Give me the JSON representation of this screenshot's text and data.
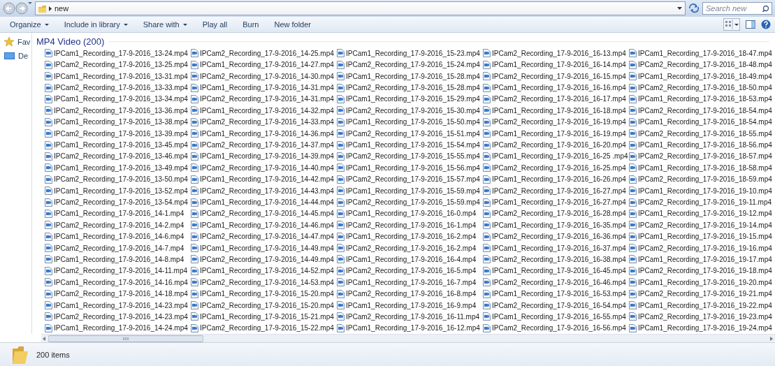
{
  "address_bar": {
    "path": "new",
    "search": {
      "placeholder": "Search new"
    }
  },
  "toolbar": {
    "buttons": [
      {
        "label": "Organize",
        "kind": "menu"
      },
      {
        "label": "Include in library",
        "kind": "menu"
      },
      {
        "label": "Share with",
        "kind": "menu"
      },
      {
        "label": "Play all",
        "kind": "plain"
      },
      {
        "label": "Burn",
        "kind": "plain"
      },
      {
        "label": "New folder",
        "kind": "plain"
      }
    ]
  },
  "navigation": [
    {
      "label": "Fav",
      "kind": "favorites"
    },
    {
      "label": "De",
      "kind": "desktop"
    }
  ],
  "group": {
    "title": "MP4 Video (200)",
    "files": [
      "IPCam1_Recording_17-9-2016_13-24.mp4",
      "IPCam2_Recording_17-9-2016_13-25.mp4",
      "IPCam1_Recording_17-9-2016_13-31.mp4",
      "IPCam2_Recording_17-9-2016_13-33.mp4",
      "IPCam1_Recording_17-9-2016_13-34.mp4",
      "IPCam2_Recording_17-9-2016_13-36.mp4",
      "IPCam1_Recording_17-9-2016_13-38.mp4",
      "IPCam2_Recording_17-9-2016_13-39.mp4",
      "IPCam1_Recording_17-9-2016_13-45.mp4",
      "IPCam2_Recording_17-9-2016_13-46.mp4",
      "IPCam1_Recording_17-9-2016_13-49.mp4",
      "IPCam2_Recording_17-9-2016_13-50.mp4",
      "IPCam1_Recording_17-9-2016_13-52.mp4",
      "IPCam2_Recording_17-9-2016_13-54.mp4",
      "IPCam1_Recording_17-9-2016_14-1.mp4",
      "IPCam2_Recording_17-9-2016_14-2.mp4",
      "IPCam1_Recording_17-9-2016_14-6.mp4",
      "IPCam2_Recording_17-9-2016_14-7.mp4",
      "IPCam1_Recording_17-9-2016_14-8.mp4",
      "IPCam2_Recording_17-9-2016_14-11.mp4",
      "IPCam1_Recording_17-9-2016_14-16.mp4",
      "IPCam2_Recording_17-9-2016_14-18.mp4",
      "IPCam1_Recording_17-9-2016_14-23.mp4",
      "IPCam2_Recording_17-9-2016_14-23.mp4",
      "IPCam1_Recording_17-9-2016_14-24.mp4",
      "IPCam2_Recording_17-9-2016_14-25.mp4",
      "IPCam1_Recording_17-9-2016_14-27.mp4",
      "IPCam2_Recording_17-9-2016_14-30.mp4",
      "IPCam1_Recording_17-9-2016_14-31.mp4",
      "IPCam2_Recording_17-9-2016_14-31.mp4",
      "IPCam1_Recording_17-9-2016_14-32.mp4",
      "IPCam2_Recording_17-9-2016_14-33.mp4",
      "IPCam1_Recording_17-9-2016_14-36.mp4",
      "IPCam2_Recording_17-9-2016_14-37.mp4",
      "IPCam1_Recording_17-9-2016_14-39.mp4",
      "IPCam2_Recording_17-9-2016_14-40.mp4",
      "IPCam1_Recording_17-9-2016_14-42.mp4",
      "IPCam2_Recording_17-9-2016_14-43.mp4",
      "IPCam1_Recording_17-9-2016_14-44.mp4",
      "IPCam2_Recording_17-9-2016_14-45.mp4",
      "IPCam1_Recording_17-9-2016_14-46.mp4",
      "IPCam2_Recording_17-9-2016_14-47.mp4",
      "IPCam1_Recording_17-9-2016_14-49.mp4",
      "IPCam2_Recording_17-9-2016_14-49.mp4",
      "IPCam1_Recording_17-9-2016_14-52.mp4",
      "IPCam2_Recording_17-9-2016_14-53.mp4",
      "IPCam1_Recording_17-9-2016_15-20.mp4",
      "IPCam2_Recording_17-9-2016_15-20.mp4",
      "IPCam1_Recording_17-9-2016_15-21.mp4",
      "IPCam2_Recording_17-9-2016_15-22.mp4",
      "IPCam1_Recording_17-9-2016_15-23.mp4",
      "IPCam2_Recording_17-9-2016_15-24.mp4",
      "IPCam1_Recording_17-9-2016_15-28.mp4",
      "IPCam2_Recording_17-9-2016_15-28.mp4",
      "IPCam1_Recording_17-9-2016_15-29.mp4",
      "IPCam2_Recording_17-9-2016_15-30.mp4",
      "IPCam1_Recording_17-9-2016_15-50.mp4",
      "IPCam2_Recording_17-9-2016_15-51.mp4",
      "IPCam1_Recording_17-9-2016_15-54.mp4",
      "IPCam2_Recording_17-9-2016_15-55.mp4",
      "IPCam1_Recording_17-9-2016_15-56.mp4",
      "IPCam2_Recording_17-9-2016_15-57.mp4",
      "IPCam1_Recording_17-9-2016_15-59.mp4",
      "IPCam2_Recording_17-9-2016_15-59.mp4",
      "IPCam1_Recording_17-9-2016_16-0.mp4",
      "IPCam2_Recording_17-9-2016_16-1.mp4",
      "IPCam1_Recording_17-9-2016_16-2.mp4",
      "IPCam2_Recording_17-9-2016_16-2.mp4",
      "IPCam1_Recording_17-9-2016_16-4.mp4",
      "IPCam2_Recording_17-9-2016_16-5.mp4",
      "IPCam1_Recording_17-9-2016_16-7.mp4",
      "IPCam2_Recording_17-9-2016_16-8.mp4",
      "IPCam1_Recording_17-9-2016_16-9.mp4",
      "IPCam2_Recording_17-9-2016_16-11.mp4",
      "IPCam1_Recording_17-9-2016_16-12.mp4",
      "IPCam2_Recording_17-9-2016_16-13.mp4",
      "IPCam1_Recording_17-9-2016_16-14.mp4",
      "IPCam2_Recording_17-9-2016_16-15.mp4",
      "IPCam1_Recording_17-9-2016_16-16.mp4",
      "IPCam2_Recording_17-9-2016_16-17.mp4",
      "IPCam1_Recording_17-9-2016_16-18.mp4",
      "IPCam2_Recording_17-9-2016_16-19.mp4",
      "IPCam1_Recording_17-9-2016_16-19.mp4",
      "IPCam2_Recording_17-9-2016_16-20.mp4",
      "IPCam1_Recording_17-9-2016_16-25 .mp4",
      "IPCam2_Recording_17-9-2016_16-25.mp4",
      "IPCam1_Recording_17-9-2016_16-26.mp4",
      "IPCam2_Recording_17-9-2016_16-27.mp4",
      "IPCam1_Recording_17-9-2016_16-27.mp4",
      "IPCam2_Recording_17-9-2016_16-28.mp4",
      "IPCam1_Recording_17-9-2016_16-35.mp4",
      "IPCam2_Recording_17-9-2016_16-36.mp4",
      "IPCam1_Recording_17-9-2016_16-37.mp4",
      "IPCam2_Recording_17-9-2016_16-38.mp4",
      "IPCam1_Recording_17-9-2016_16-45.mp4",
      "IPCam2_Recording_17-9-2016_16-46.mp4",
      "IPCam1_Recording_17-9-2016_16-53.mp4",
      "IPCam2_Recording_17-9-2016_16-54.mp4",
      "IPCam1_Recording_17-9-2016_16-55.mp4",
      "IPCam2_Recording_17-9-2016_16-56.mp4",
      "IPCam1_Recording_17-9-2016_18-47.mp4",
      "IPCam2_Recording_17-9-2016_18-48.mp4",
      "IPCam1_Recording_17-9-2016_18-49.mp4",
      "IPCam2_Recording_17-9-2016_18-50.mp4",
      "IPCam1_Recording_17-9-2016_18-53.mp4",
      "IPCam2_Recording_17-9-2016_18-54.mp4",
      "IPCam1_Recording_17-9-2016_18-54.mp4",
      "IPCam2_Recording_17-9-2016_18-55.mp4",
      "IPCam1_Recording_17-9-2016_18-56.mp4",
      "IPCam2_Recording_17-9-2016_18-57.mp4",
      "IPCam1_Recording_17-9-2016_18-58.mp4",
      "IPCam2_Recording_17-9-2016_18-59.mp4",
      "IPCam1_Recording_17-9-2016_19-10.mp4",
      "IPCam2_Recording_17-9-2016_19-11.mp4",
      "IPCam1_Recording_17-9-2016_19-12.mp4",
      "IPCam2_Recording_17-9-2016_19-14.mp4",
      "IPCam1_Recording_17-9-2016_19-15.mp4",
      "IPCam2_Recording_17-9-2016_19-16.mp4",
      "IPCam1_Recording_17-9-2016_19-17.mp4",
      "IPCam2_Recording_17-9-2016_19-18.mp4",
      "IPCam1_Recording_17-9-2016_19-20.mp4",
      "IPCam2_Recording_17-9-2016_19-21.mp4",
      "IPCam1_Recording_17-9-2016_19-22.mp4",
      "IPCam2_Recording_17-9-2016_19-23.mp4",
      "IPCam1_Recording_17-9-2016_19-24.mp4"
    ]
  },
  "status_bar": {
    "count": "200 items"
  }
}
